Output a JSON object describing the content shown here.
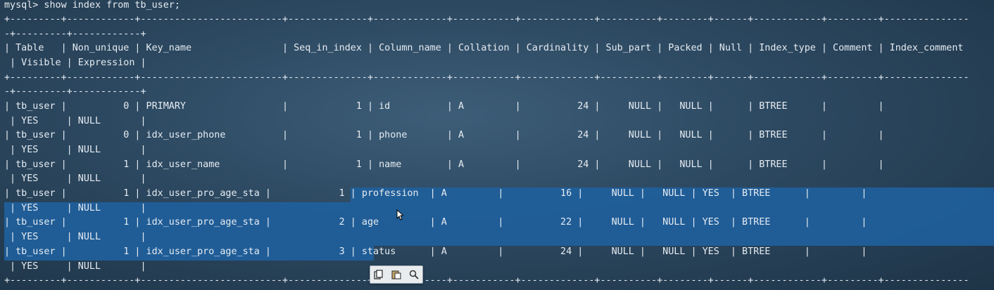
{
  "terminal": {
    "lines": [
      "mysql> show index from tb_user;",
      "+---------+------------+-------------------------+--------------+-------------+-----------+-------------+----------+--------+------+------------+---------+---------------",
      "-+---------+------------+",
      "| Table   | Non_unique | Key_name                | Seq_in_index | Column_name | Collation | Cardinality | Sub_part | Packed | Null | Index_type | Comment | Index_comment",
      " | Visible | Expression |",
      "+---------+------------+-------------------------+--------------+-------------+-----------+-------------+----------+--------+------+------------+---------+---------------",
      "-+---------+------------+",
      "| tb_user |          0 | PRIMARY                 |            1 | id          | A         |          24 |     NULL |   NULL |      | BTREE      |         |",
      " | YES     | NULL       |",
      "| tb_user |          0 | idx_user_phone          |            1 | phone       | A         |          24 |     NULL |   NULL |      | BTREE      |         |",
      " | YES     | NULL       |",
      "| tb_user |          1 | idx_user_name           |            1 | name        | A         |          24 |     NULL |   NULL |      | BTREE      |         |",
      " | YES     | NULL       |",
      "| tb_user |          1 | idx_user_pro_age_sta |            1 | profession  | A         |          16 |     NULL |   NULL | YES  | BTREE      |         |",
      " | YES     | NULL       |",
      "| tb_user |          1 | idx_user_pro_age_sta |            2 | age         | A         |          22 |     NULL |   NULL | YES  | BTREE      |         |",
      " | YES     | NULL       |",
      "| tb_user |          1 | idx_user_pro_age_sta |            3 | status      | A         |          24 |     NULL |   NULL | YES  | BTREE      |         |",
      " | YES     | NULL       |",
      "+---------+------------+-------------------------+--------------+-------------+-----------+-------------+----------+--------+------+------------+---------+---------------"
    ]
  },
  "toolbar": {
    "icons": [
      "copy-icon",
      "paste-icon",
      "search-icon"
    ]
  },
  "colors": {
    "selection": "#1f5f9c",
    "text": "#e6ecf2"
  }
}
